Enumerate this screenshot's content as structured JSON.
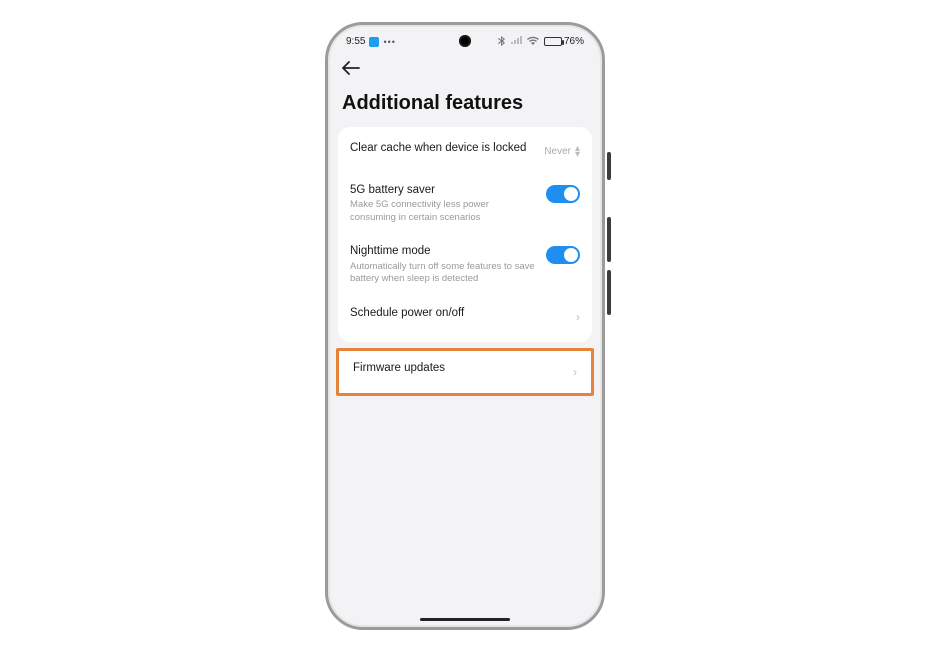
{
  "status": {
    "time": "9:55",
    "battery_pct": "76%"
  },
  "page": {
    "title": "Additional features"
  },
  "rows": {
    "clear_cache": {
      "title": "Clear cache when device is locked",
      "value": "Never"
    },
    "battery_saver": {
      "title": "5G battery saver",
      "sub": "Make 5G connectivity less power consuming in certain scenarios",
      "on": true
    },
    "nighttime": {
      "title": "Nighttime mode",
      "sub": "Automatically turn off some features to save battery when sleep is detected",
      "on": true
    },
    "schedule": {
      "title": "Schedule power on/off"
    },
    "firmware": {
      "title": "Firmware updates"
    }
  }
}
